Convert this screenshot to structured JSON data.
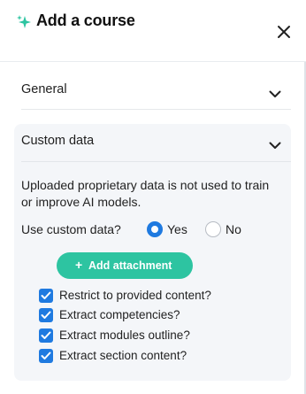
{
  "header": {
    "title": "Add a course",
    "sparkle_icon": "sparkle-icon",
    "close_icon": "close-icon"
  },
  "sections": {
    "general": {
      "label": "General",
      "icon": "chevron-down-icon"
    },
    "custom_data": {
      "label": "Custom data",
      "icon": "chevron-down-icon"
    }
  },
  "custom_data": {
    "description": "Uploaded proprietary data is not used to train or improve AI models.",
    "question": "Use custom data?",
    "options": [
      {
        "label": "Yes",
        "selected": true
      },
      {
        "label": "No",
        "selected": false
      }
    ],
    "add_attachment": {
      "icon": "+",
      "label": "Add attachment"
    },
    "checkboxes": [
      {
        "label": "Restrict to provided content?",
        "checked": true
      },
      {
        "label": "Extract competencies?",
        "checked": true
      },
      {
        "label": "Extract modules outline?",
        "checked": true
      },
      {
        "label": "Extract section content?",
        "checked": true
      }
    ]
  },
  "colors": {
    "accent_blue": "#1f7ae0",
    "accent_teal": "#2dc4a1",
    "panel_bg": "#f4f6f9"
  }
}
